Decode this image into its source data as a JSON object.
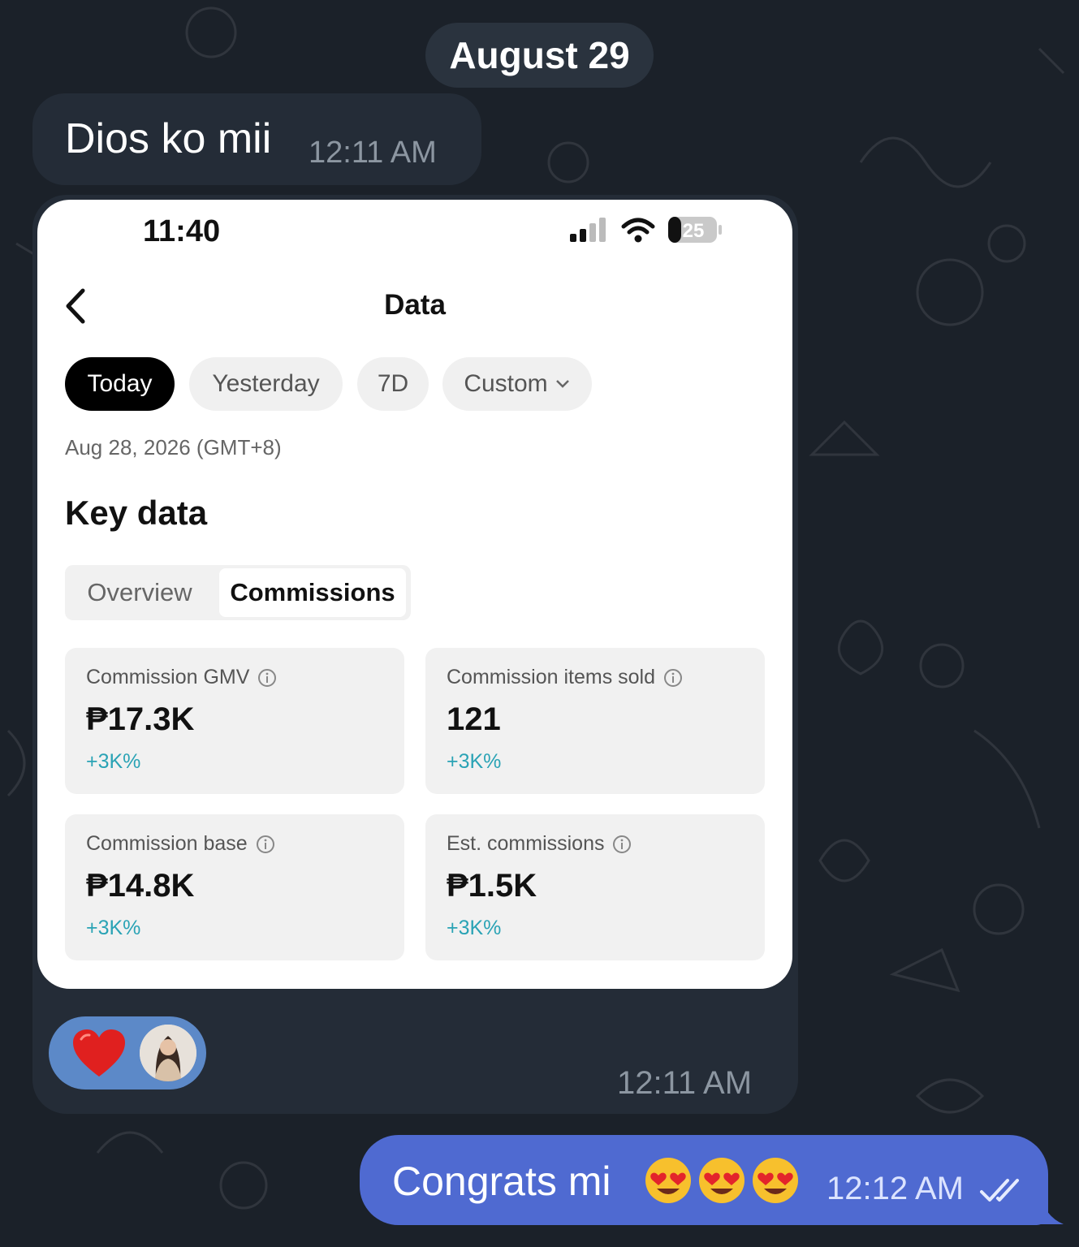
{
  "chat": {
    "date_divider": "August 29",
    "incoming_text": "Dios ko mii",
    "incoming_time": "12:11 AM",
    "media_time": "12:11 AM",
    "outgoing_text": "Congrats mi",
    "outgoing_time": "12:12 AM"
  },
  "phone": {
    "status_time": "11:40",
    "battery": "25",
    "title": "Data",
    "chips": [
      "Today",
      "Yesterday",
      "7D",
      "Custom"
    ],
    "date_line": "Aug 28, 2026 (GMT+8)",
    "section_title": "Key data",
    "tabs": [
      "Overview",
      "Commissions"
    ],
    "metrics": [
      {
        "label": "Commission GMV",
        "value": "₱17.3K",
        "change": "+3K%"
      },
      {
        "label": "Commission items sold",
        "value": "121",
        "change": "+3K%"
      },
      {
        "label": "Commission base",
        "value": "₱14.8K",
        "change": "+3K%"
      },
      {
        "label": "Est. commissions",
        "value": "₱1.5K",
        "change": "+3K%"
      }
    ]
  },
  "icons": [
    "back-chevron-icon",
    "signal-icon",
    "wifi-icon",
    "battery-icon",
    "info-icon",
    "heart-icon",
    "heart-eyes-emoji",
    "double-check-icon"
  ],
  "colors": {
    "chat_bg": "#1b2129",
    "bubble_in": "#242c37",
    "bubble_out": "#4f6ad1",
    "reaction_bg": "#5c89c8",
    "change_accent": "#2aa3b5"
  }
}
